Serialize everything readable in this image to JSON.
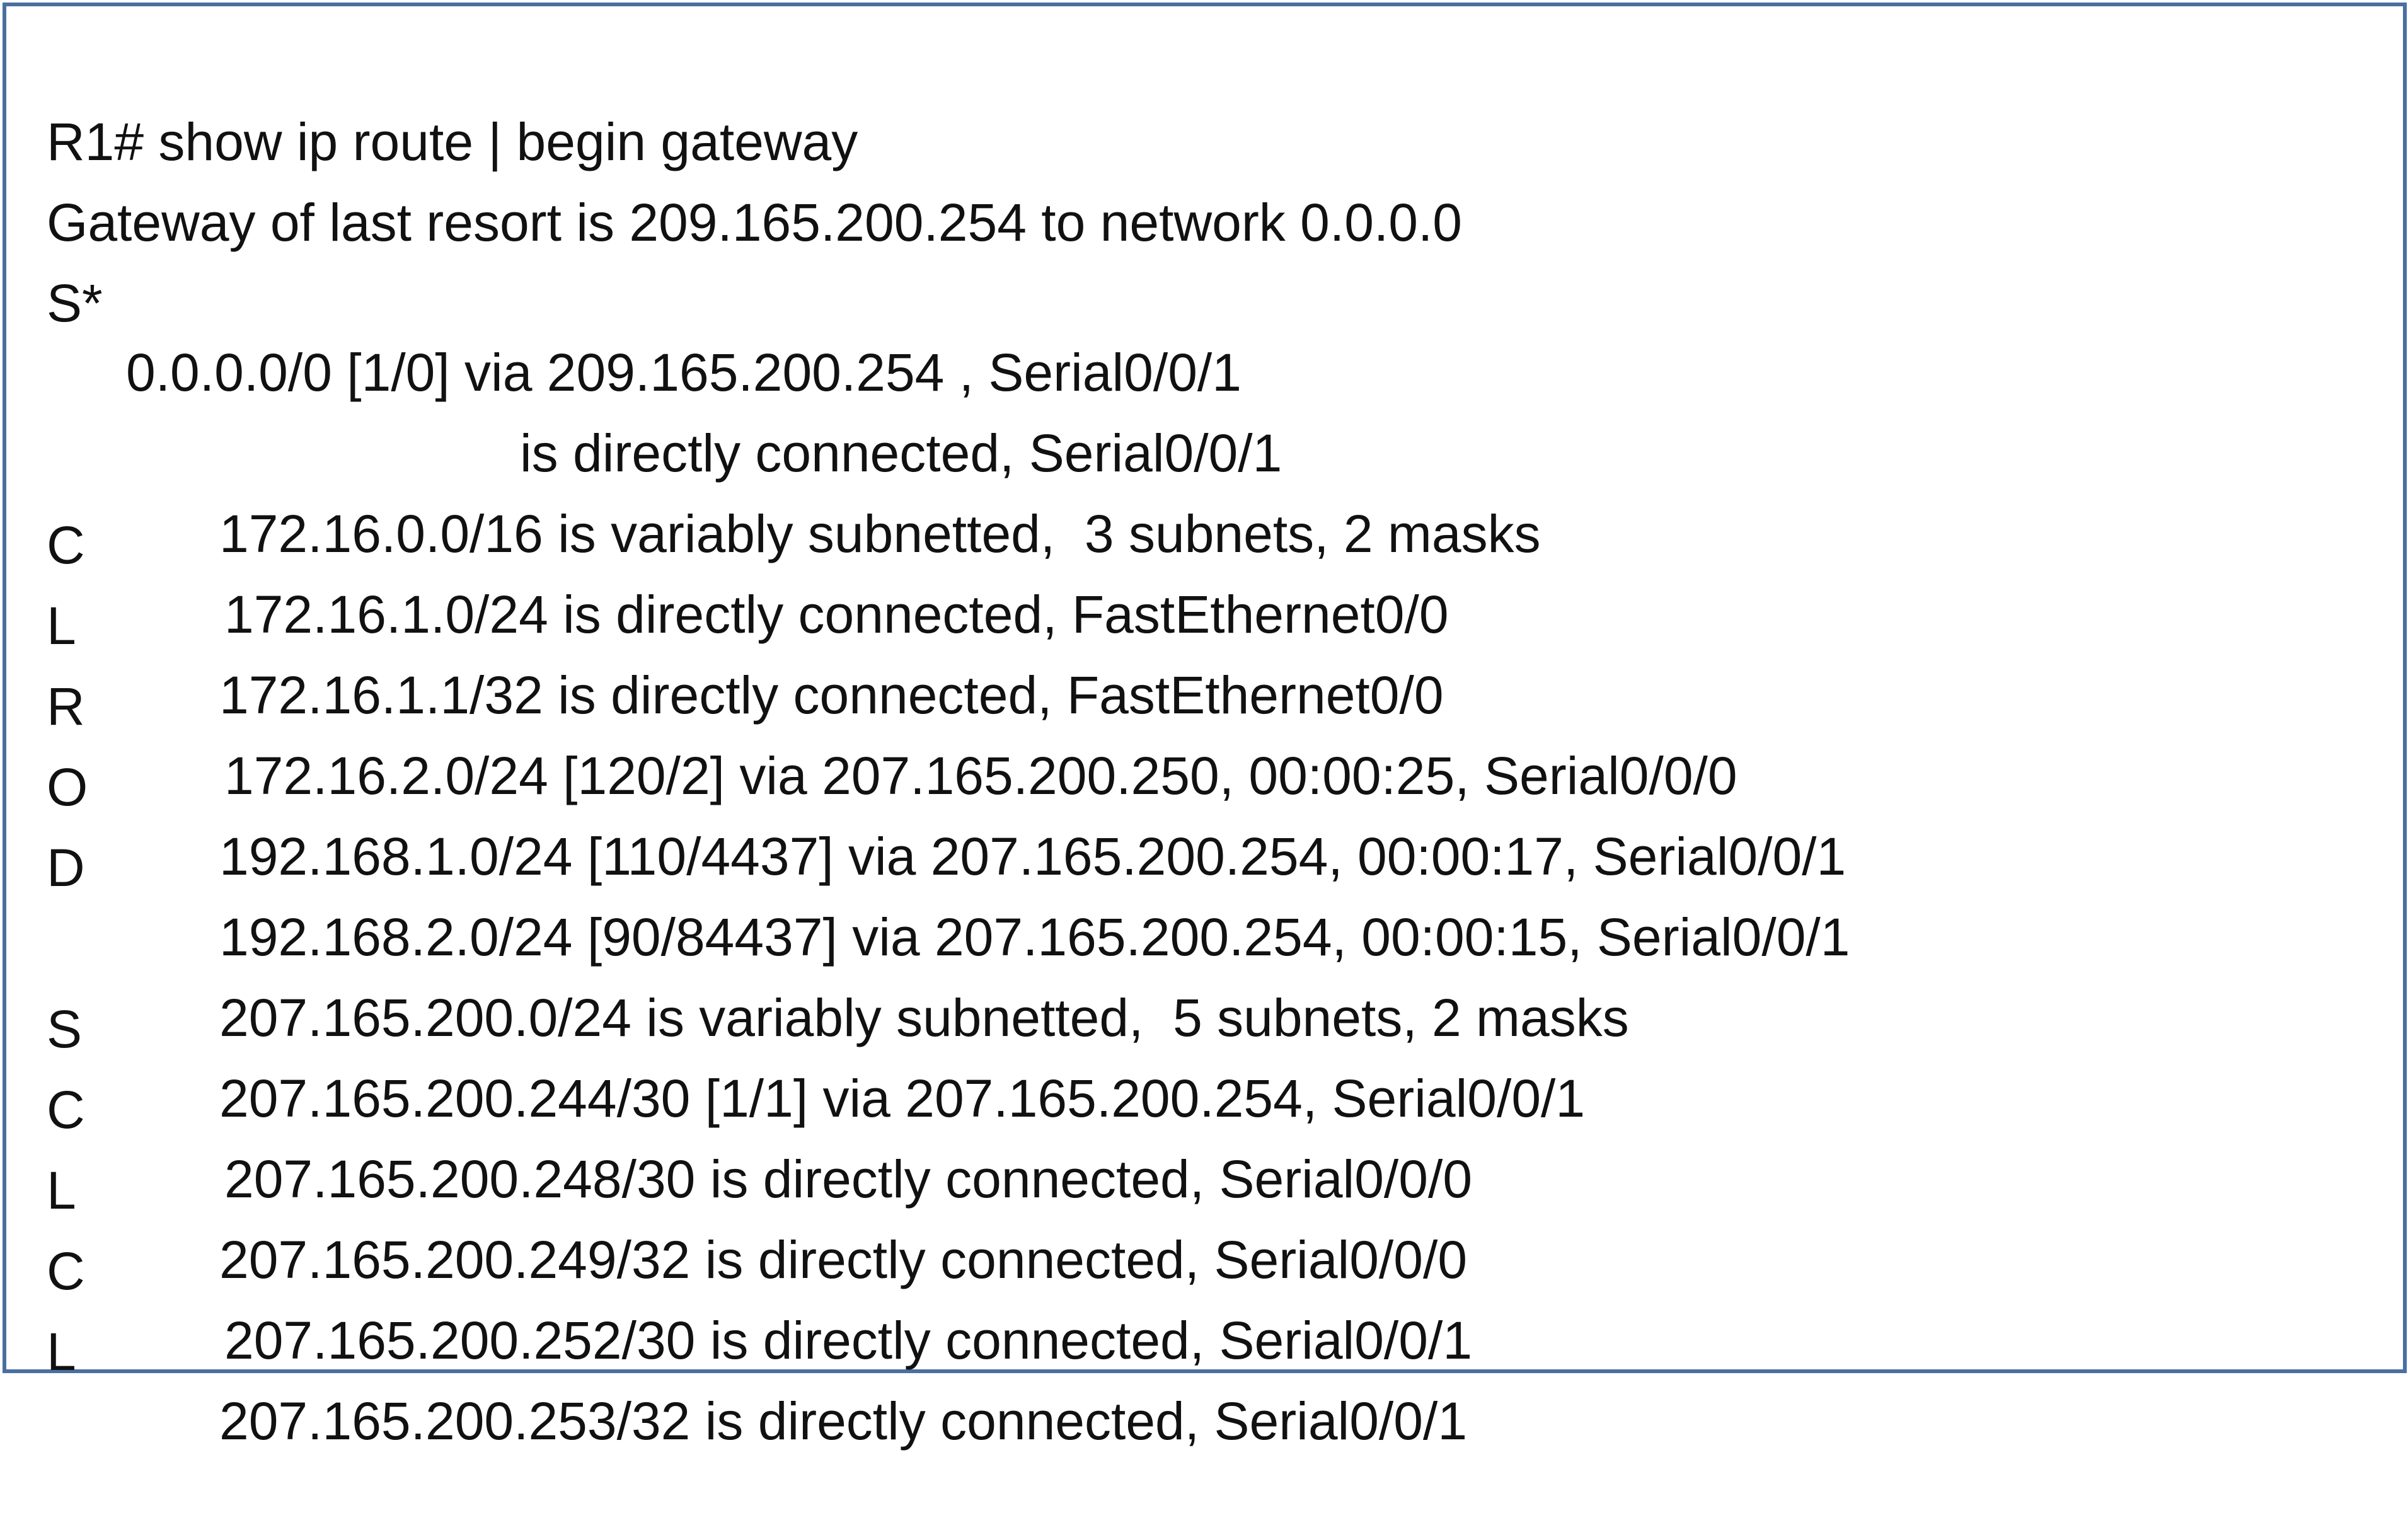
{
  "terminal": {
    "command": "R1# show ip route | begin gateway",
    "gateway": "Gateway of last resort is 209.165.200.254 to network 0.0.0.0",
    "routes": [
      {
        "code": "S*",
        "text": "0.0.0.0/0 [1/0] via 209.165.200.254 , Serial0/0/1"
      },
      {
        "code": "",
        "text": "is directly connected, Serial0/0/1"
      },
      {
        "code": "",
        "text": "172.16.0.0/16 is variably subnetted,  3 subnets, 2 masks"
      },
      {
        "code": "C",
        "text": "172.16.1.0/24 is directly connected, FastEthernet0/0"
      },
      {
        "code": "L",
        "text": "172.16.1.1/32 is directly connected, FastEthernet0/0"
      },
      {
        "code": "R",
        "text": "172.16.2.0/24 [120/2] via 207.165.200.250, 00:00:25, Serial0/0/0"
      },
      {
        "code": "O",
        "text": "192.168.1.0/24 [110/4437] via 207.165.200.254, 00:00:17, Serial0/0/1"
      },
      {
        "code": "D",
        "text": "192.168.2.0/24 [90/84437] via 207.165.200.254, 00:00:15, Serial0/0/1"
      },
      {
        "code": "",
        "text": "207.165.200.0/24 is variably subnetted,  5 subnets, 2 masks"
      },
      {
        "code": "S",
        "text": "207.165.200.244/30 [1/1] via 207.165.200.254, Serial0/0/1"
      },
      {
        "code": "C",
        "text": "207.165.200.248/30 is directly connected, Serial0/0/0"
      },
      {
        "code": "L",
        "text": "207.165.200.249/32 is directly connected, Serial0/0/0"
      },
      {
        "code": "C",
        "text": "207.165.200.252/30 is directly connected, Serial0/0/1"
      },
      {
        "code": "L",
        "text": "207.165.200.253/32 is directly connected, Serial0/0/1"
      }
    ]
  }
}
